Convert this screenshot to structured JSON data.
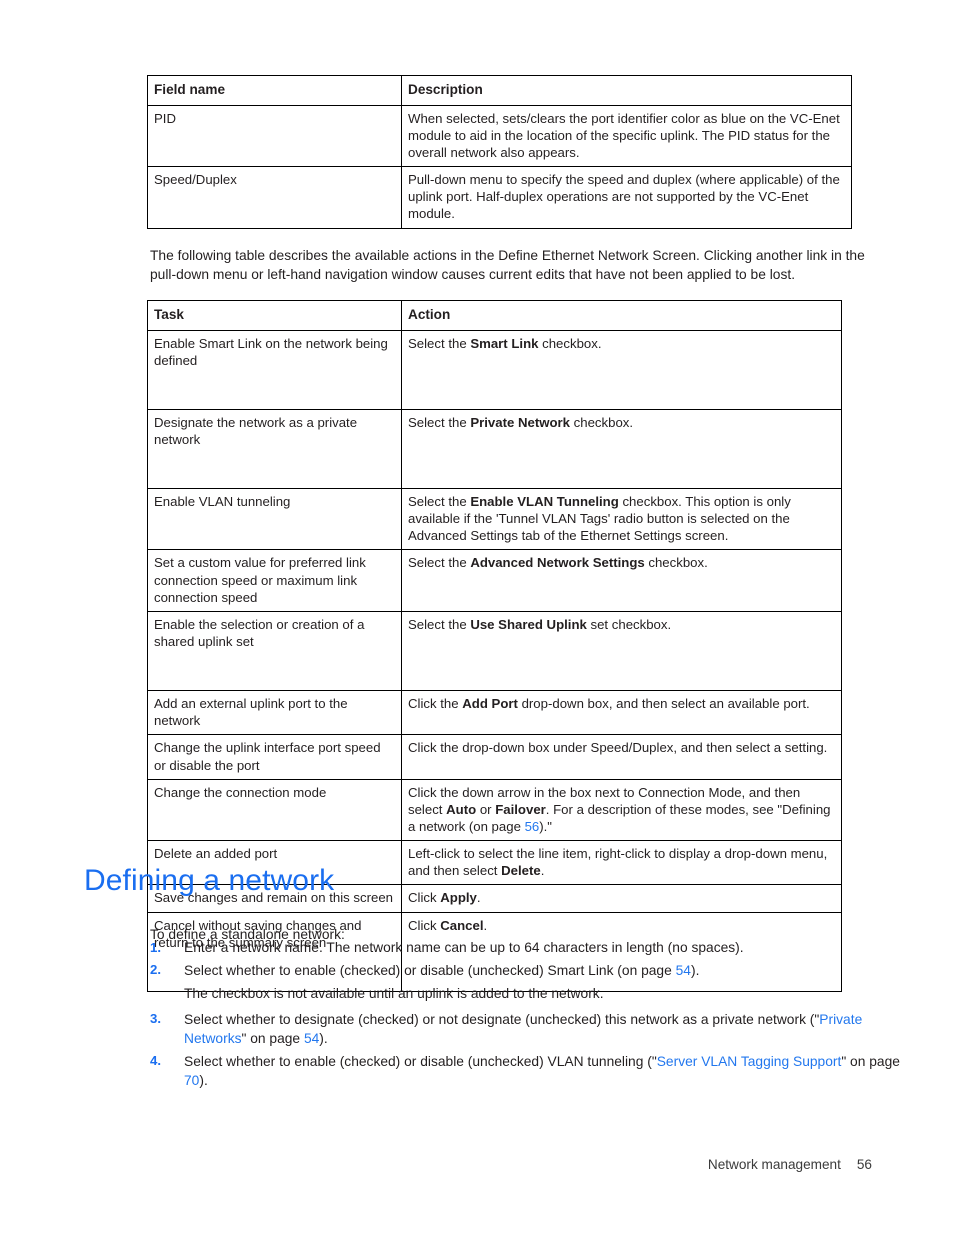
{
  "table_field_desc": {
    "headers": [
      "Field name",
      "Description"
    ],
    "rows": [
      {
        "field": "PID",
        "description": "When selected, sets/clears the port identifier color as blue on the VC-Enet module to aid in the location of the specific uplink. The PID status for the overall network also appears."
      },
      {
        "field": "Speed/Duplex",
        "description": "Pull-down menu to specify the speed and duplex (where applicable) of the uplink port. Half-duplex operations are not supported by the VC-Enet module."
      }
    ]
  },
  "intro_paragraph": "The following table describes the available actions in the Define Ethernet Network Screen. Clicking another link in the pull-down menu or left-hand navigation window causes current edits that have not been applied to be lost.",
  "table_task_action": {
    "headers": [
      "Task",
      "Action"
    ],
    "rows": [
      {
        "task": "Enable Smart Link on the network being defined",
        "action_pre": "Select the ",
        "action_bold": "Smart Link",
        "action_post": " checkbox."
      },
      {
        "task": "Designate the network as a private network",
        "action_pre": "Select the ",
        "action_bold": "Private Network",
        "action_post": " checkbox."
      },
      {
        "task": "Enable VLAN tunneling",
        "action_pre": "Select the ",
        "action_bold": "Enable VLAN Tunneling",
        "action_post": " checkbox. This option is only available if the 'Tunnel VLAN Tags' radio button is selected on the Advanced Settings tab of the Ethernet Settings screen."
      },
      {
        "task": "Set a custom value for preferred link connection speed or maximum link connection speed",
        "action_pre": "Select the ",
        "action_bold": "Advanced Network Settings",
        "action_post": " checkbox."
      },
      {
        "task": "Enable the selection or creation of a shared uplink set",
        "action_pre": "Select the ",
        "action_bold": "Use Shared Uplink",
        "action_post": " set checkbox."
      },
      {
        "task": "Add an external uplink port to the network",
        "action_pre": "Click the ",
        "action_bold": "Add Port",
        "action_post": " drop-down box, and then select an available port."
      },
      {
        "task": "Change the uplink interface port speed or disable the port",
        "action_pre": "Click the drop-down box under Speed/Duplex, and then select a setting.",
        "action_bold": "",
        "action_post": ""
      },
      {
        "task": "Change the connection mode",
        "action_pre": "Click the down arrow in the box next to Connection Mode, and then select ",
        "action_bold": "Auto",
        "action_mid": " or ",
        "action_bold2": "Failover",
        "action_post": ". For a description of these modes, see \"Defining a network (on page ",
        "action_page": "56",
        "action_tail": ").\""
      },
      {
        "task": "Delete an added port",
        "action_pre": "Left-click to select the line item, right-click to display a drop-down menu, and then select ",
        "action_bold": "Delete",
        "action_post": "."
      },
      {
        "task": "Save changes and remain on this screen",
        "action_pre": "Click ",
        "action_bold": "Apply",
        "action_post": "."
      },
      {
        "task": "Cancel without saving changes and return to the summary screen",
        "action_pre": "Click ",
        "action_bold": "Cancel",
        "action_post": "."
      }
    ]
  },
  "section": {
    "heading": "Defining a network",
    "lead": "To define a standalone network:"
  },
  "steps": [
    {
      "num": "1.",
      "text": "Enter a network name. The network name can be up to 64 characters in length (no spaces)."
    },
    {
      "num": "2.",
      "pre": "Select whether to enable (checked) or disable (unchecked) Smart Link (on page ",
      "page": "54",
      "post": ").",
      "note": "The checkbox is not available until an uplink is added to the network."
    },
    {
      "num": "3.",
      "pre": "Select whether to designate (checked) or not designate (unchecked) this network as a private network (\"",
      "link": "Private Networks",
      "mid": "\" on page ",
      "page": "54",
      "post": ")."
    },
    {
      "num": "4.",
      "pre": "Select whether to enable (checked) or disable (unchecked) VLAN tunneling (\"",
      "link": "Server VLAN Tagging Support",
      "mid": "\" on page ",
      "page": "70",
      "post": ")."
    }
  ],
  "footer": {
    "label": "Network management",
    "page": "56"
  },
  "colors": {
    "heading_blue": "#1a6ef0",
    "link_blue": "#2277ee",
    "text": "#231f20"
  }
}
